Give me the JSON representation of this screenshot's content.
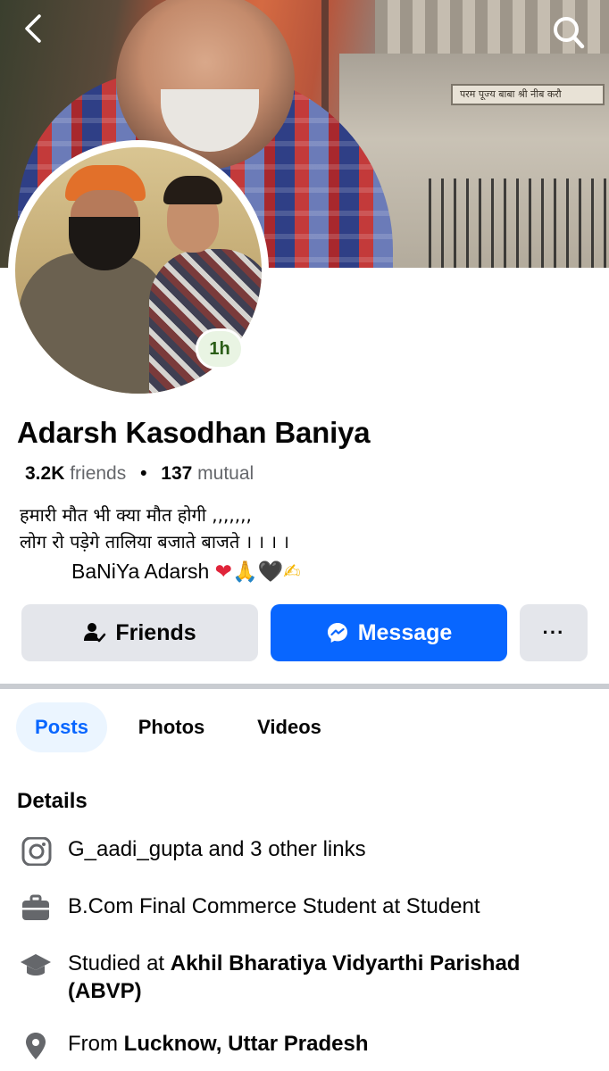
{
  "cover": {
    "inscription": "परम पूज्य बाबा श्री नीब करौ"
  },
  "header": {
    "back_icon": "chevron-left-icon",
    "search_icon": "search-icon"
  },
  "profile": {
    "story_badge": "1h",
    "name": "Adarsh Kasodhan Baniya",
    "friends_count": "3.2K",
    "friends_label": "friends",
    "separator": "•",
    "mutual_count": "137",
    "mutual_label": "mutual",
    "bio_line1": "हमारी मौत भी क्या मौत होगी ,,,,,,,",
    "bio_line2": "लोग रो पड़ेगे तालिया बजाते बाजते । । । ।",
    "bio_signature": "BaNiYa Adarsh",
    "bio_emojis": [
      "❤",
      "🙏",
      "🖤",
      "✍"
    ]
  },
  "actions": {
    "friends_label": "Friends",
    "message_label": "Message",
    "more_label": "···"
  },
  "tabs": [
    {
      "label": "Posts",
      "active": true
    },
    {
      "label": "Photos",
      "active": false
    },
    {
      "label": "Videos",
      "active": false
    }
  ],
  "details": {
    "title": "Details",
    "instagram": {
      "icon": "instagram-icon",
      "text": "G_aadi_gupta and 3 other links"
    },
    "work": {
      "icon": "briefcase-icon",
      "text": "B.Com Final Commerce  Student at Student"
    },
    "education": {
      "icon": "graduation-cap-icon",
      "prefix": "Studied at ",
      "place": "Akhil Bharatiya Vidyarthi Parishad (ABVP)"
    },
    "location": {
      "icon": "location-pin-icon",
      "prefix": "From ",
      "place": "Lucknow, Uttar Pradesh"
    }
  },
  "colors": {
    "accent": "#0866ff",
    "button_gray": "#e4e6eb",
    "active_tab_bg": "#ebf5ff",
    "badge_bg": "#e9f4e3",
    "badge_text": "#2a5d16"
  }
}
